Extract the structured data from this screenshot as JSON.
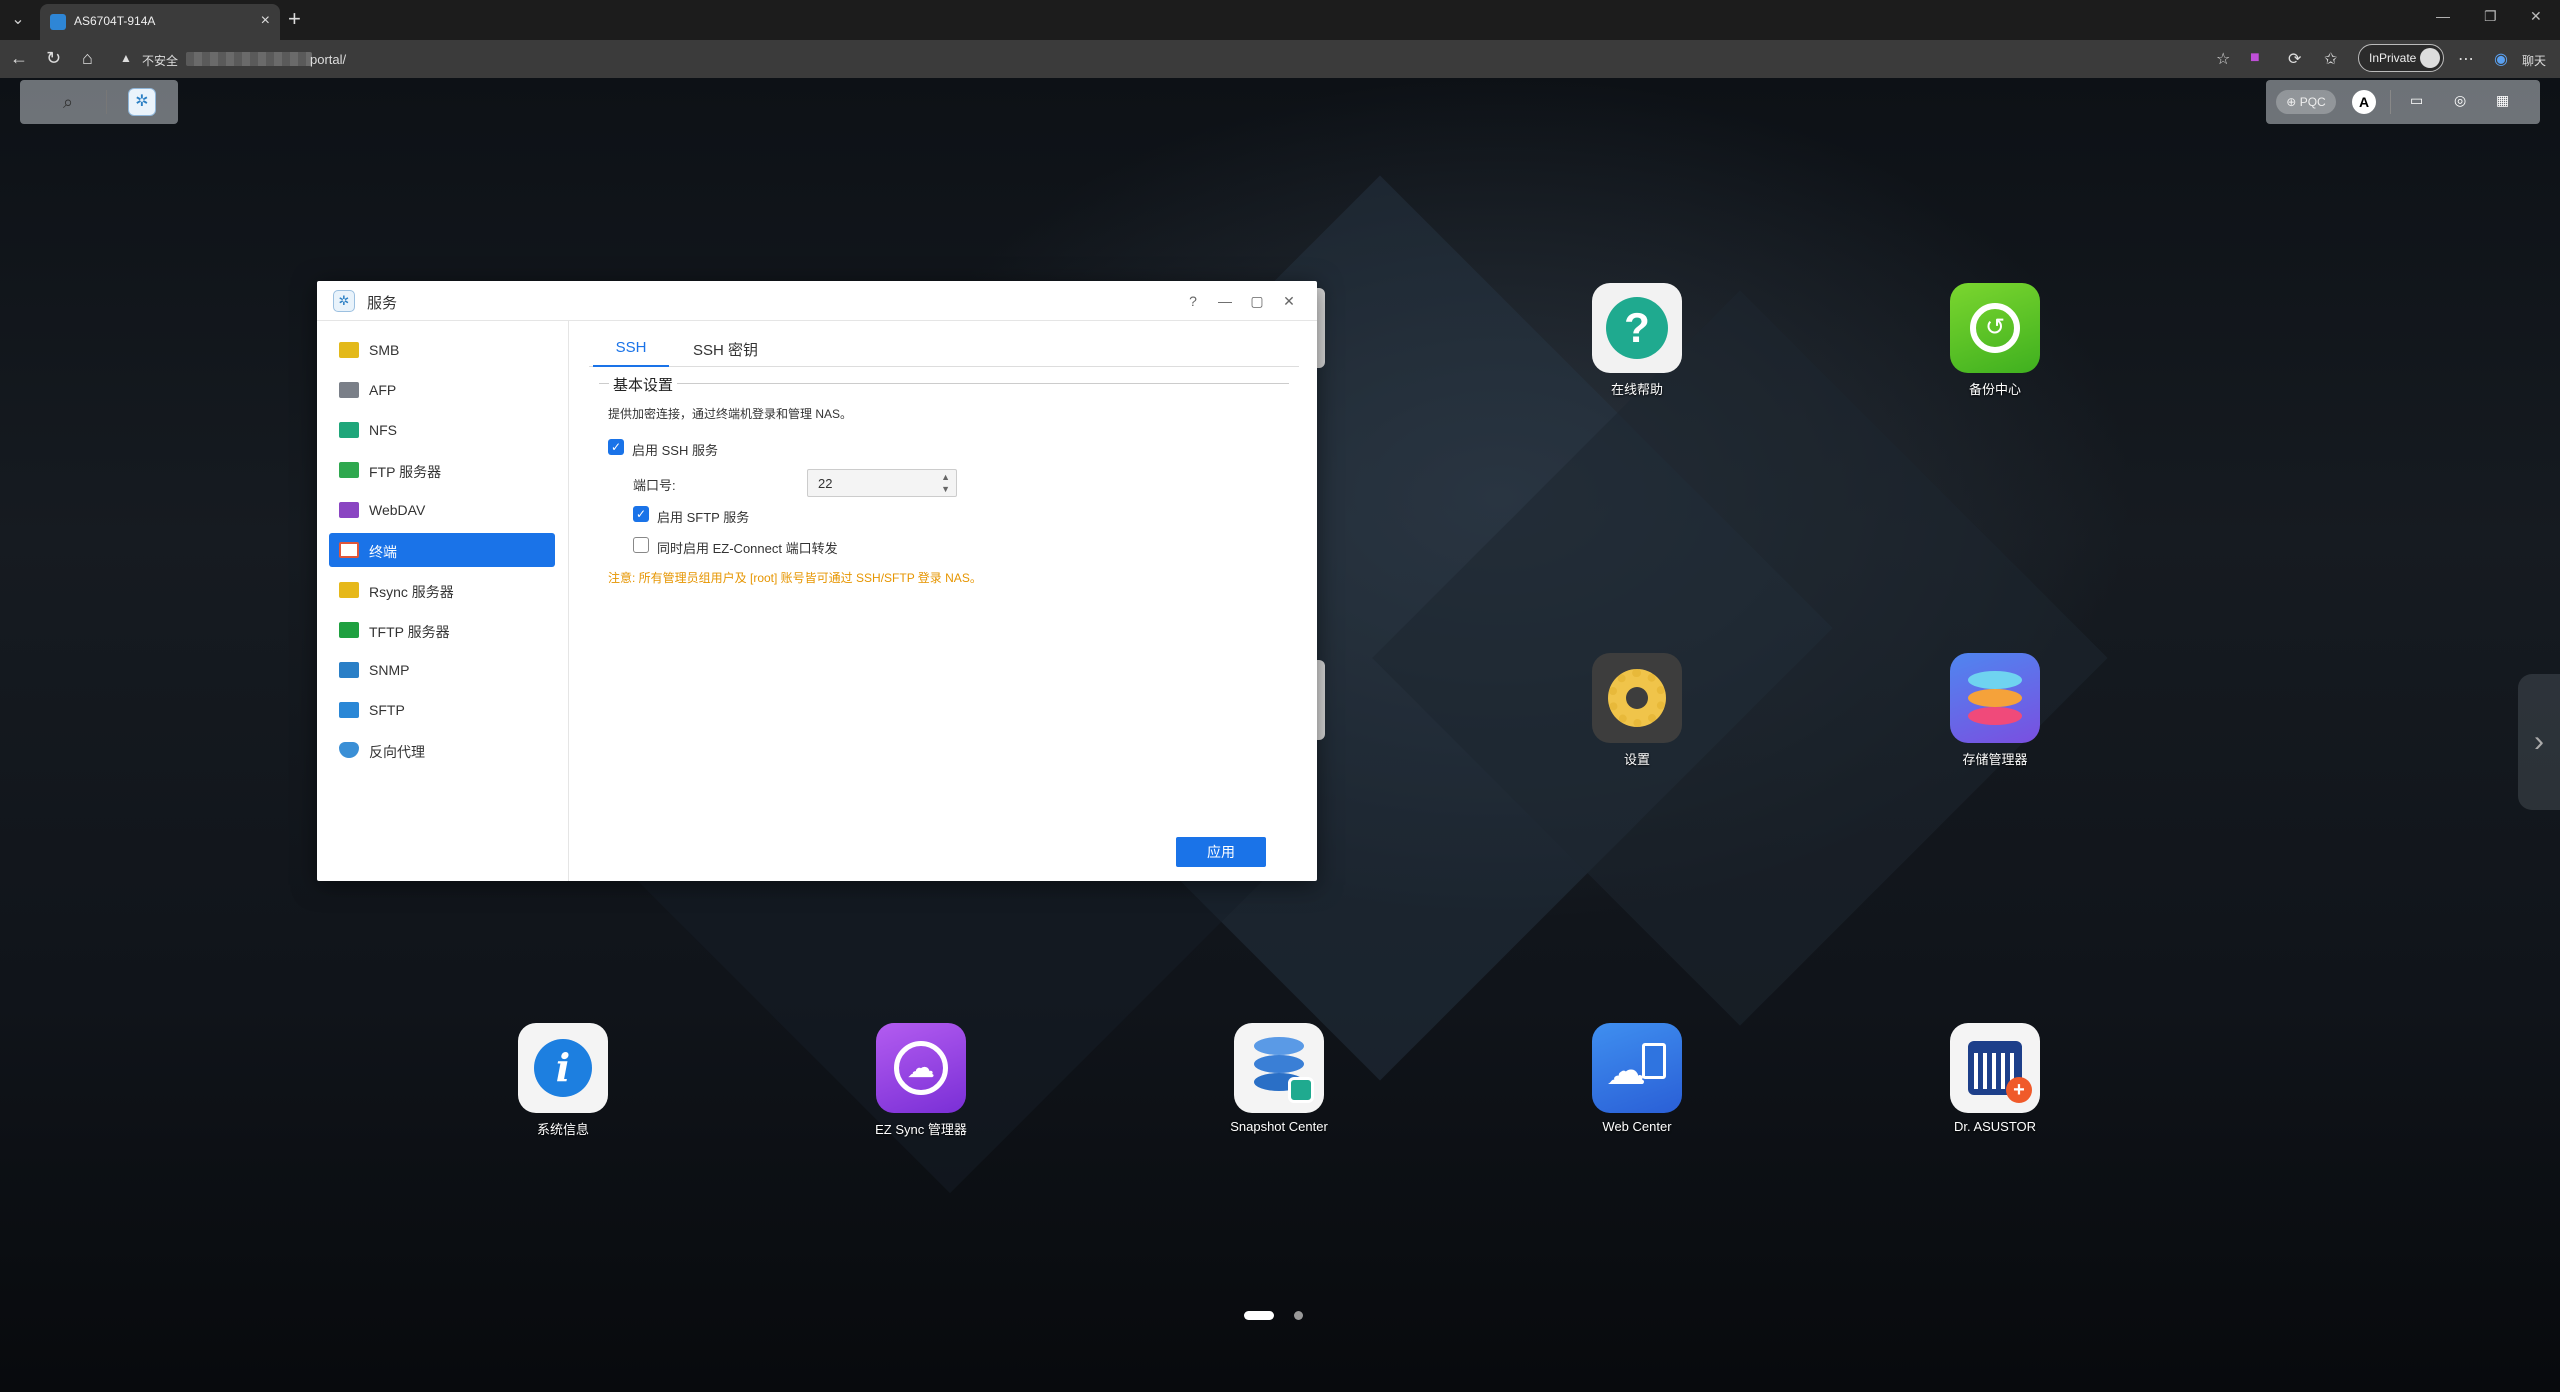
{
  "browser": {
    "tab_title": "AS6704T-914A",
    "insecure_label": "不安全",
    "url_suffix": "portal/",
    "inprivate_label": "InPrivate",
    "chat_label": "聊天"
  },
  "desktop": {
    "top_right": {
      "pqc_label": "PQC",
      "a_label": "A"
    },
    "apps": [
      {
        "label": "在线帮助",
        "color": "#1faa8f"
      },
      {
        "label": "备份中心",
        "color": "#5cc62a"
      },
      {
        "label": "设置",
        "color": "#3a3a3a"
      },
      {
        "label": "存储管理器",
        "color": "#4a63e0"
      },
      {
        "label": "系统信息",
        "color": "#1d7fe0"
      },
      {
        "label": "EZ Sync 管理器",
        "color": "#8a3fe0"
      },
      {
        "label": "Snapshot Center",
        "color": "#2f7fd6"
      },
      {
        "label": "Web Center",
        "color": "#2f74e0"
      },
      {
        "label": "Dr. ASUSTOR",
        "color": "#1d3f8a"
      }
    ]
  },
  "window": {
    "title": "服务",
    "sidebar": [
      {
        "label": "SMB",
        "color": "#e3b91a"
      },
      {
        "label": "AFP",
        "color": "#7a7f88"
      },
      {
        "label": "NFS",
        "color": "#1fa67a"
      },
      {
        "label": "FTP 服务器",
        "color": "#2fa84f"
      },
      {
        "label": "WebDAV",
        "color": "#8a45c2"
      },
      {
        "label": "终端",
        "color": "#e0553a"
      },
      {
        "label": "Rsync 服务器",
        "color": "#e6b81a"
      },
      {
        "label": "TFTP 服务器",
        "color": "#1fa040"
      },
      {
        "label": "SNMP",
        "color": "#2a7fc7"
      },
      {
        "label": "SFTP",
        "color": "#2a87d6"
      },
      {
        "label": "反向代理",
        "color": "#3a8fd6"
      }
    ],
    "active_item": "终端",
    "tabs": [
      {
        "label": "SSH"
      },
      {
        "label": "SSH 密钥"
      }
    ],
    "section_title": "基本设置",
    "description": "提供加密连接，通过终端机登录和管理 NAS。",
    "enable_ssh": {
      "label": "启用 SSH 服务",
      "checked": true
    },
    "port": {
      "label": "端口号:",
      "value": "22"
    },
    "enable_sftp": {
      "label": "启用 SFTP 服务",
      "checked": true
    },
    "ez_connect": {
      "label": "同时启用 EZ-Connect 端口转发",
      "checked": false
    },
    "warning": "注意: 所有管理员组用户及 [root] 账号皆可通过 SSH/SFTP 登录 NAS。",
    "apply_label": "应用"
  }
}
